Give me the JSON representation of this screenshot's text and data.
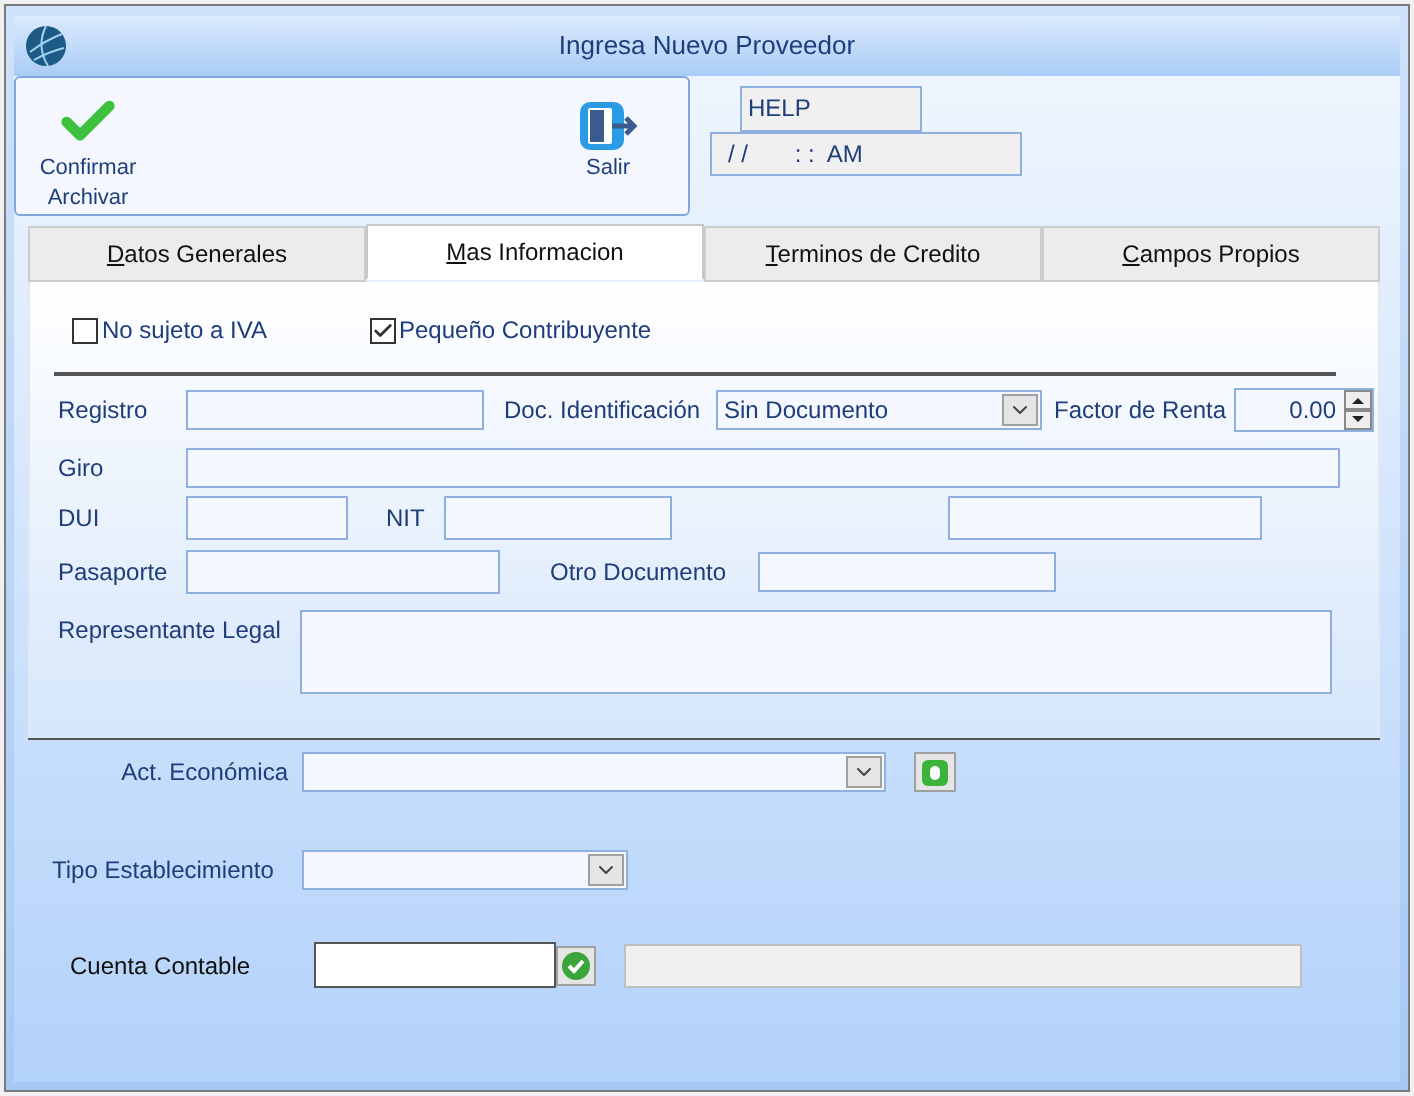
{
  "window": {
    "title": "Ingresa Nuevo Proveedor"
  },
  "toolbar": [
    {
      "kind": "confirm",
      "label": "Confirmar Archivar"
    },
    {
      "kind": "exit",
      "label": "Salir"
    }
  ],
  "help_field": {
    "value": "HELP"
  },
  "date_field": {
    "value": "/ /       : :  AM"
  },
  "tabs": [
    {
      "label": "Datos Generales",
      "selected": false
    },
    {
      "label": "Mas Informacion",
      "selected": true
    },
    {
      "label": "Terminos de Credito",
      "selected": false
    },
    {
      "label": "Campos Propios",
      "selected": false
    }
  ],
  "checkboxes": [
    {
      "label": "No sujeto a IVA",
      "checked": false
    },
    {
      "label": "Pequeño Contribuyente",
      "checked": true
    }
  ],
  "form": {
    "registro": {
      "label": "Registro"
    },
    "doc_identificacion": {
      "label": "Doc. Identificación",
      "value": "Sin Documento"
    },
    "factor_renta": {
      "label": "Factor de Renta",
      "value": "0.00"
    },
    "giro": {
      "label": "Giro"
    },
    "dui": {
      "label": "DUI"
    },
    "nit": {
      "label": "NIT"
    },
    "pasaporte": {
      "label": "Pasaporte"
    },
    "otro_documento": {
      "label": "Otro Documento"
    },
    "representante_legal": {
      "label": "Representante Legal"
    }
  },
  "lower": {
    "act_economica": {
      "label": "Act. Económica"
    },
    "tipo_establecimiento": {
      "label": "Tipo Establecimiento"
    },
    "cuenta_contable": {
      "label": "Cuenta Contable"
    }
  }
}
